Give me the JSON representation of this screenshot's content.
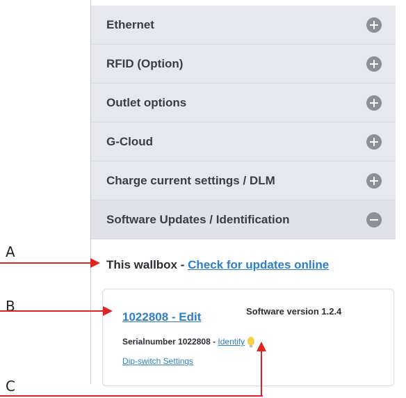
{
  "accordion": [
    {
      "label": "Ethernet",
      "state": "collapsed",
      "icon": "plus-circle-icon"
    },
    {
      "label": "RFID (Option)",
      "state": "collapsed",
      "icon": "plus-circle-icon"
    },
    {
      "label": "Outlet options",
      "state": "collapsed",
      "icon": "plus-circle-icon"
    },
    {
      "label": "G-Cloud",
      "state": "collapsed",
      "icon": "plus-circle-icon"
    },
    {
      "label": "Charge current settings / DLM",
      "state": "collapsed",
      "icon": "plus-circle-icon"
    },
    {
      "label": "Software Updates / Identification",
      "state": "expanded",
      "icon": "minus-circle-icon"
    }
  ],
  "software_updates": {
    "wallbox_prefix": "This wallbox - ",
    "check_link": "Check for updates online",
    "device_link": "1022808 - Edit",
    "software_version": "Software version 1.2.4",
    "serial_prefix": "Serialnumber 1022808 - ",
    "identify_link": "Identify",
    "dip_link": "Dip-switch Settings"
  },
  "annotations": {
    "A": "A",
    "B": "B",
    "C": "C",
    "arrow_color": "#e02323"
  }
}
